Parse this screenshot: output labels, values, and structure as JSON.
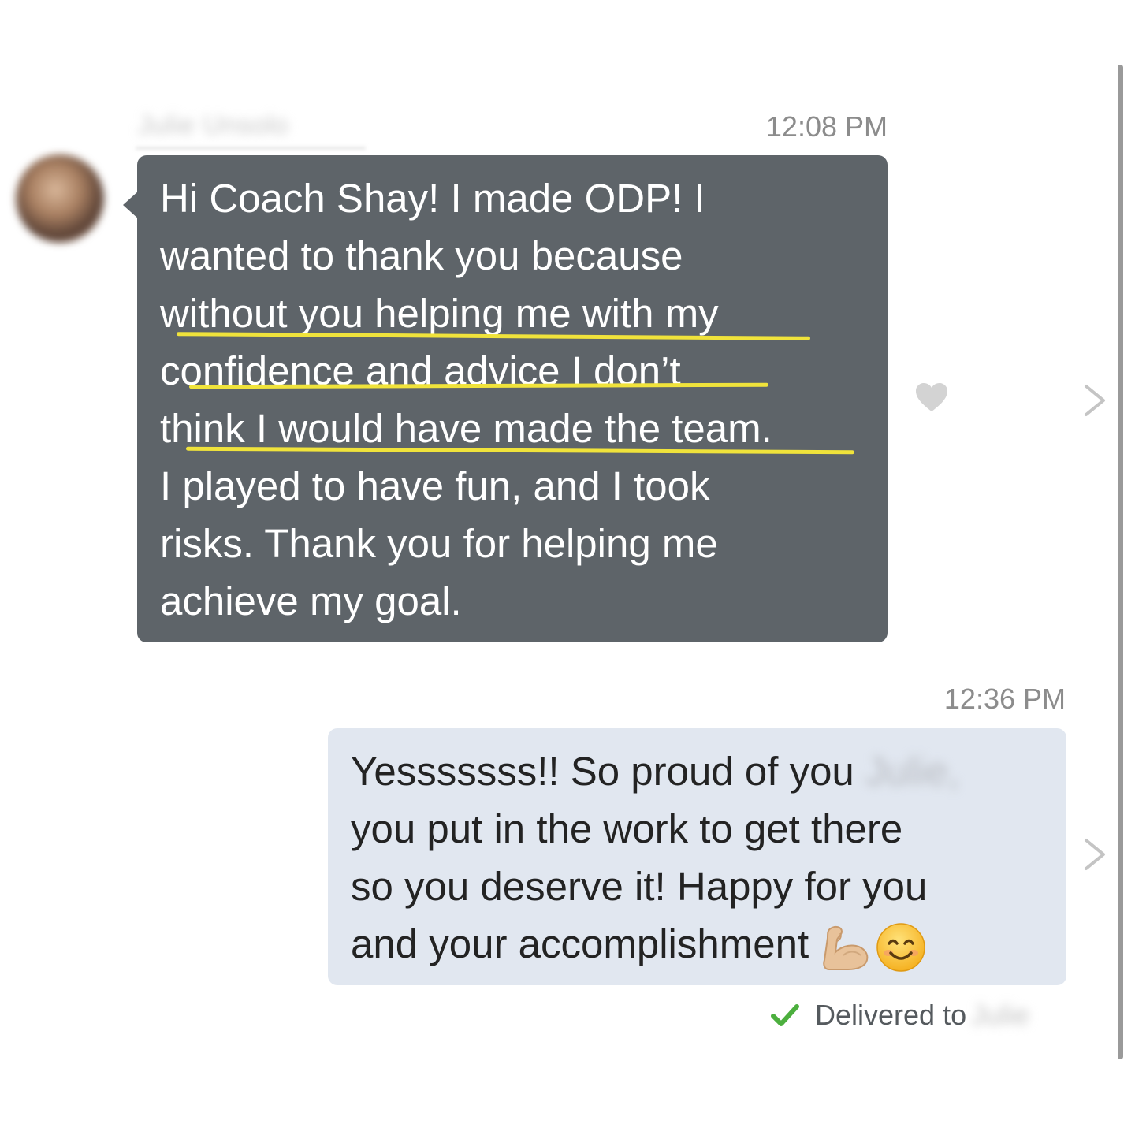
{
  "thread": {
    "incoming": {
      "sender_name": "Julie Unsolo",
      "timestamp": "12:08 PM",
      "lines": [
        "Hi Coach Shay! I made ODP! I",
        "wanted to thank you because",
        "without you helping me with my",
        "confidence and advice I don’t",
        "think I would have made the team.",
        "I played to have fun, and I took",
        "risks. Thank you for helping me",
        "achieve my goal."
      ],
      "highlight_color": "#f0e33b",
      "bubble_color": "#5e6469",
      "reaction_icon": "heart-icon",
      "action_icon": "chevron-right-icon"
    },
    "outgoing": {
      "timestamp": "12:36 PM",
      "line1_prefix": "Yesssssss!! So proud of you ",
      "line1_name_blurred": "Julie,",
      "lines": [
        "you put in the work to get there",
        "so you deserve it! Happy for you",
        "and your accomplishment "
      ],
      "emojis": [
        "flexed-biceps-icon",
        "smiling-face-icon"
      ],
      "bubble_color": "#e1e7f0",
      "action_icon": "chevron-right-icon",
      "status": {
        "icon": "checkmark-icon",
        "text": "Delivered to",
        "name_blurred": "Julie",
        "check_color": "#4caf3e"
      }
    }
  }
}
